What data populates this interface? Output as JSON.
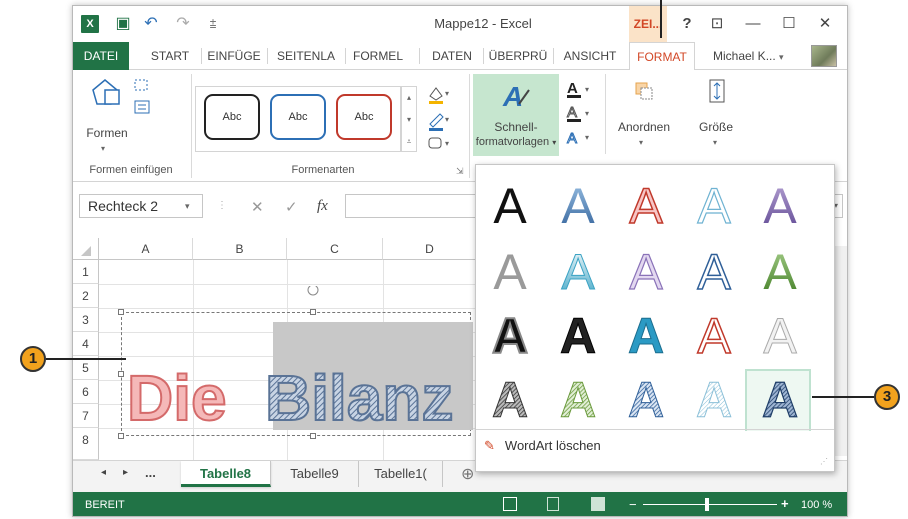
{
  "window": {
    "title": "Mappe12 - Excel",
    "contextual_tab": "ZEI...",
    "help": "?",
    "ribbon_display": "⊡",
    "minimize": "—",
    "maximize": "☐",
    "close": "✕"
  },
  "qat": {
    "app_icon": "X",
    "save": "▣",
    "undo": "↶",
    "redo": "↷",
    "customize": "⩲"
  },
  "tabs": [
    "DATEI",
    "START",
    "EINFÜGE",
    "SEITENLA",
    "FORMEL",
    "DATEN",
    "ÜBERPRÜ",
    "ANSICHT",
    "FORMAT"
  ],
  "user": {
    "name": "Michael K...",
    "dropdown": "▾"
  },
  "ribbon": {
    "group_insert_shapes": {
      "button": "Formen",
      "label": "Formen einfügen"
    },
    "group_shape_styles": {
      "label": "Formenarten",
      "swatches": [
        "Abc",
        "Abc",
        "Abc"
      ]
    },
    "group_wordart": {
      "button_line1": "Schnell-",
      "button_line2": "formatvorlagen",
      "dropdown": "▾"
    },
    "arrange": {
      "label": "Anordnen"
    },
    "size": {
      "label": "Größe"
    }
  },
  "formula_bar": {
    "name_box": "Rechteck 2",
    "cancel": "✕",
    "enter": "✓",
    "fx": "fx"
  },
  "grid": {
    "columns": [
      "A",
      "B",
      "C",
      "D"
    ],
    "rows": [
      "1",
      "2",
      "3",
      "4",
      "5",
      "6",
      "7",
      "8"
    ]
  },
  "wordart": {
    "text_part1": "Die",
    "text_part2": "Bilanz",
    "letter": "A",
    "clear_label": "WordArt löschen",
    "styles": [
      [
        "black-plain",
        "blue-gradient",
        "red-outline-shadow",
        "light-blue-outline",
        "purple-gradient"
      ],
      [
        "gray-plain",
        "teal-gradient",
        "lavender-outline",
        "blue-outline",
        "green-gradient"
      ],
      [
        "black-bold-shadow",
        "black-bold",
        "teal-bold",
        "red-outline",
        "gray-light"
      ],
      [
        "dark-pattern",
        "green-pattern",
        "blue-pattern",
        "light-pattern",
        "navy-pattern-selected"
      ]
    ]
  },
  "sheets": {
    "ellipsis": "...",
    "tabs": [
      "Tabelle8",
      "Tabelle9",
      "Tabelle1("
    ],
    "add": "⊕"
  },
  "status": {
    "ready": "BEREIT",
    "zoom": "100 %"
  },
  "callouts": [
    "1",
    "3"
  ],
  "colors": {
    "excel_green": "#217346",
    "format_orange": "#d24726",
    "callout": "#f2a21d"
  }
}
